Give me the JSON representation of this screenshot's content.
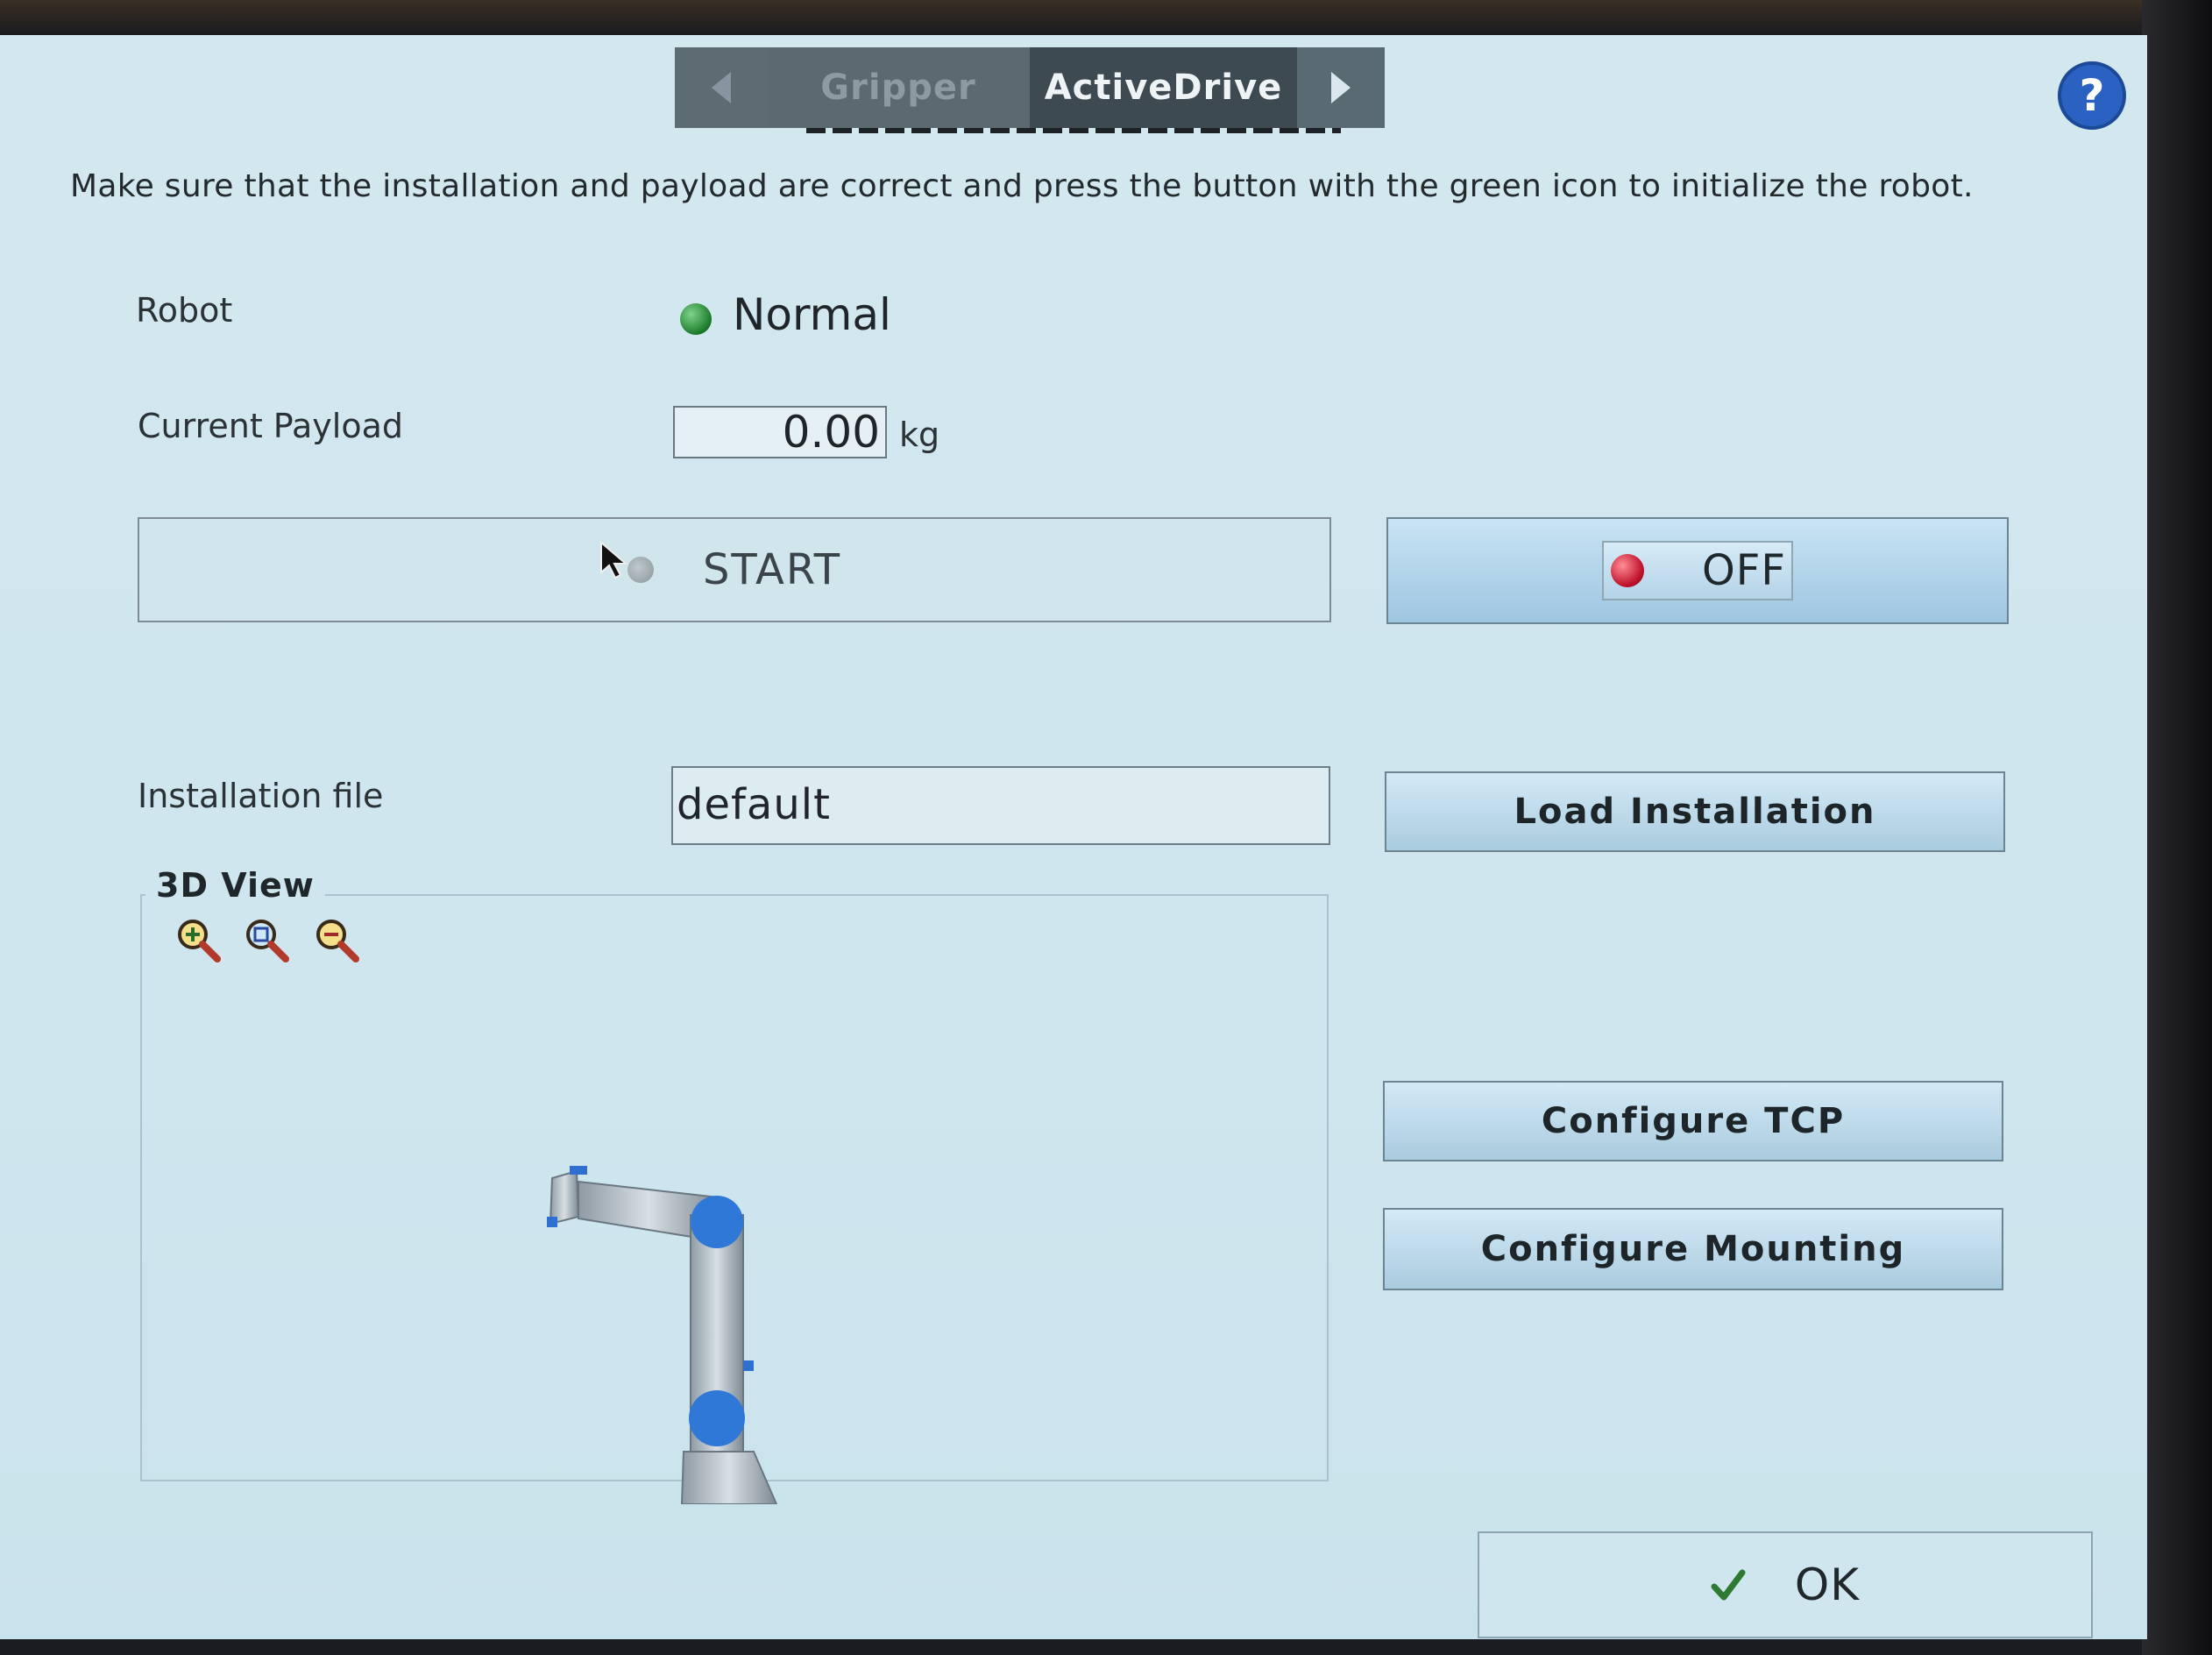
{
  "tabs": {
    "prev_icon": "chevron-left-icon",
    "items": [
      {
        "label": "Gripper",
        "active": false
      },
      {
        "label": "ActiveDrive",
        "active": true
      }
    ],
    "next_icon": "chevron-right-icon"
  },
  "help": {
    "icon": "help-icon",
    "glyph": "?"
  },
  "instructions": "Make sure that the installation and payload are correct and press the button with the green icon to initialize the robot.",
  "robot": {
    "label": "Robot",
    "status": "Normal",
    "status_color": "#1b7a2a"
  },
  "payload": {
    "label": "Current Payload",
    "value": "0.00",
    "unit": "kg"
  },
  "start_button": {
    "label": "START"
  },
  "off_button": {
    "label": "OFF",
    "indicator_color": "#c0122a"
  },
  "installation": {
    "label": "Installation file",
    "value": "default",
    "load_button": "Load Installation"
  },
  "view3d": {
    "title": "3D View",
    "zoom_icons": [
      "zoom-in-icon",
      "zoom-reset-icon",
      "zoom-out-icon"
    ]
  },
  "configure_tcp_button": "Configure TCP",
  "configure_mounting_button": "Configure Mounting",
  "ok_button": {
    "label": "OK",
    "icon": "checkmark-icon"
  },
  "colors": {
    "accent_blue": "#2b62c2",
    "screen_bg": "#cfe6ee"
  }
}
